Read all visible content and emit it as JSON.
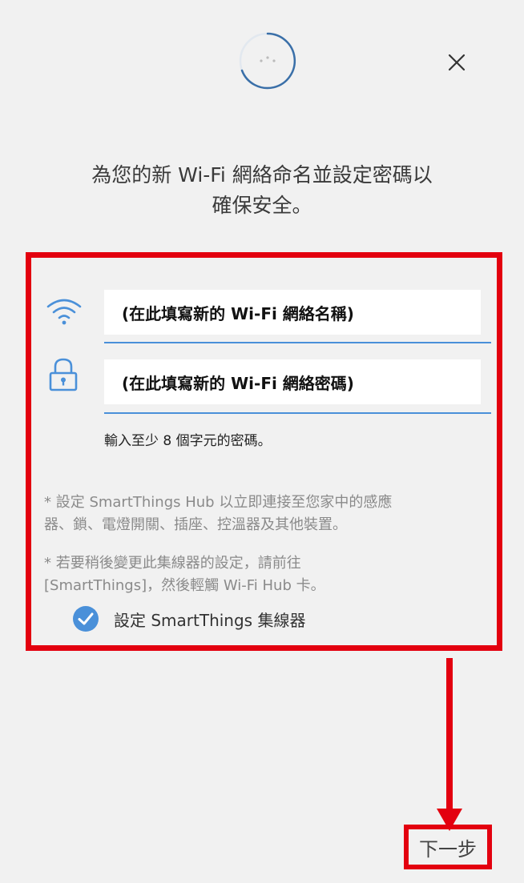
{
  "header": {
    "spinner_text": "·:·",
    "close_icon": "close-icon"
  },
  "title": {
    "line1": "為您的新 Wi-Fi 網絡命名並設定密碼以",
    "line2": "確保安全。"
  },
  "form": {
    "network_name_value": "(在此填寫新的 Wi-Fi 網絡名稱)",
    "password_value": "(在此填寫新的 Wi-Fi 網絡密碼)",
    "password_hint": "輸入至少 8 個字元的密碼。",
    "wifi_icon": "wifi-icon",
    "lock_icon": "lock-icon"
  },
  "notes": {
    "note1_line1": "* 設定 SmartThings Hub 以立即連接至您家中的感應",
    "note1_line2": "器、鎖、電燈開關、插座、控溫器及其他裝置。",
    "note2_line1": "* 若要稍後變更此集線器的設定，請前往",
    "note2_line2": "[SmartThings]，然後輕觸 Wi-Fi Hub 卡。"
  },
  "checkbox": {
    "label": "設定 SmartThings 集線器",
    "checked": true
  },
  "footer": {
    "next_label": "下一步"
  },
  "colors": {
    "highlight": "#e3000f",
    "accent": "#4a90d9",
    "background": "#f1f1f1"
  }
}
